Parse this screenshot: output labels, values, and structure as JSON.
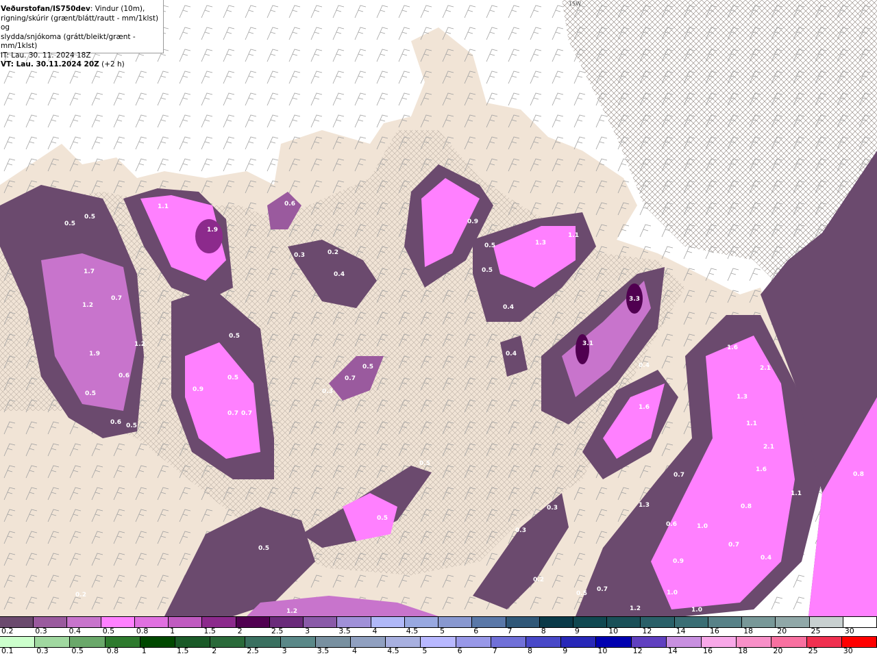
{
  "title": {
    "source": "Veðurstofan/IS750dev",
    "description_line1": ": Vindur (10m),",
    "description_line2": "rigning/skúrir (grænt/blátt/rautt - mm/1klst) og",
    "description_line3": "slydda/snjókoma (grátt/bleikt/grænt - mm/1klst)",
    "it": "IT: Lau. 30. 11. 2024 18Z",
    "vt": "VT: Lau. 30.11.2024 20Z",
    "vt_offset": " (+2 h)"
  },
  "grid_label": "15W",
  "map_colors": {
    "sea": "#ffffff",
    "land": "#f1e4d6",
    "borders": "#e8906a",
    "hatch": "#8a8078",
    "wind_barbs": "#a0a0a0"
  },
  "precip_labels": [
    "1.1",
    "0.5",
    "0.5",
    "1.9",
    "0.6",
    "0.3",
    "0.2",
    "0.4",
    "1.7",
    "0.7",
    "1.2",
    "1.9",
    "1.2",
    "0.6",
    "0.5",
    "0.6",
    "0.5",
    "0.5",
    "0.5",
    "0.9",
    "0.7",
    "0.7",
    "0.5",
    "0.7",
    "0.3",
    "0.9",
    "0.5",
    "0.5",
    "1.3",
    "1.1",
    "0.4",
    "0.4",
    "3.3",
    "3.1",
    "0.4",
    "1.6",
    "1.6",
    "2.1",
    "1.3",
    "1.1",
    "2.1",
    "1.6",
    "1.1",
    "0.8",
    "0.7",
    "1.3",
    "0.6",
    "1.0",
    "0.8",
    "0.7",
    "0.4",
    "0.9",
    "1.0",
    "1.0",
    "0.5",
    "0.7",
    "1.2",
    "0.3",
    "0.3",
    "0.2",
    "0.5",
    "0.5",
    "0.5",
    "1.2",
    "0.2"
  ],
  "legend_snow": {
    "labels": [
      "0.2",
      "0.3",
      "0.4",
      "0.5",
      "0.8",
      "1",
      "1.5",
      "2",
      "2.5",
      "3",
      "3.5",
      "4",
      "4.5",
      "5",
      "6",
      "7",
      "8",
      "9",
      "10",
      "12",
      "14",
      "16",
      "18",
      "20",
      "25",
      "30"
    ],
    "colors": [
      "#6b4a6e",
      "#9a5a9e",
      "#c874cc",
      "#ff80ff",
      "#e070e0",
      "#c05ac0",
      "#8c2a8c",
      "#500050",
      "#6a2a7a",
      "#8a5aa8",
      "#a090d8",
      "#b0b8f8",
      "#98a8e0",
      "#8898d0",
      "#5a78a8",
      "#305878",
      "#0a3a48",
      "#104850",
      "#1a5058",
      "#2a6068",
      "#3a6e74",
      "#588288",
      "#789898",
      "#90a8a8",
      "#c8d0d0",
      "#ffffff"
    ]
  },
  "legend_rain": {
    "labels": [
      "0.1",
      "0.3",
      "0.5",
      "0.8",
      "1",
      "1.5",
      "2",
      "2.5",
      "3",
      "3.5",
      "4",
      "4.5",
      "5",
      "6",
      "7",
      "8",
      "9",
      "10",
      "12",
      "14",
      "16",
      "18",
      "20",
      "25",
      "30"
    ],
    "colors": [
      "#ccffcc",
      "#a0d8a0",
      "#6aa86a",
      "#2e7a2e",
      "#004800",
      "#1a5a28",
      "#2a6a3a",
      "#3a7060",
      "#5a8888",
      "#7890a0",
      "#90a0c0",
      "#a8b0e0",
      "#b8b8ff",
      "#9898e8",
      "#7070d8",
      "#4848c8",
      "#2828b8",
      "#0000b0",
      "#6040c0",
      "#c890e0",
      "#f8a8e8",
      "#f890c8",
      "#f870a0",
      "#f03050",
      "#ff0000"
    ]
  }
}
